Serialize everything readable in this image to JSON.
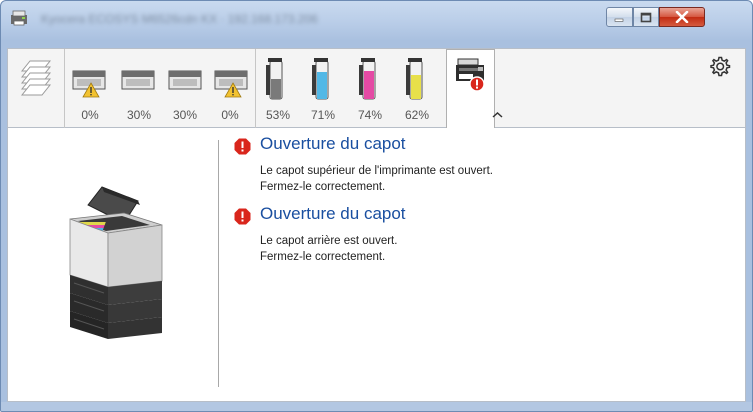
{
  "window": {
    "title": "Kyocera ECOSYS M6526cdn KX · 192.168.173.206"
  },
  "status_tabs": {
    "trays": [
      {
        "percent": "0%",
        "warning": true
      },
      {
        "percent": "30%",
        "warning": false
      },
      {
        "percent": "30%",
        "warning": false
      },
      {
        "percent": "0%",
        "warning": true
      }
    ],
    "toners": [
      {
        "percent": "53%",
        "color": "#7a7a7a",
        "level": 0.53
      },
      {
        "percent": "71%",
        "color": "#52b8e6",
        "level": 0.71
      },
      {
        "percent": "74%",
        "color": "#e44aa4",
        "level": 0.74
      },
      {
        "percent": "62%",
        "color": "#e8e04a",
        "level": 0.62
      }
    ]
  },
  "colors": {
    "accent_blue": "#1a4fa0",
    "error_red": "#d9261c"
  },
  "messages": [
    {
      "title": "Ouverture du capot",
      "lines": [
        "Le capot supérieur de l'imprimante est ouvert.",
        "Fermez-le correctement."
      ]
    },
    {
      "title": "Ouverture du capot",
      "lines": [
        "Le capot arrière est ouvert.",
        "Fermez-le correctement."
      ]
    }
  ],
  "icons": {
    "app": "printer-app-icon",
    "paper": "paper-stack-icon",
    "tray": "paper-tray-icon",
    "toner": "toner-cartridge-icon",
    "device": "device-error-icon",
    "settings": "gear-icon",
    "collapse": "chevron-up-icon",
    "error": "error-icon"
  }
}
